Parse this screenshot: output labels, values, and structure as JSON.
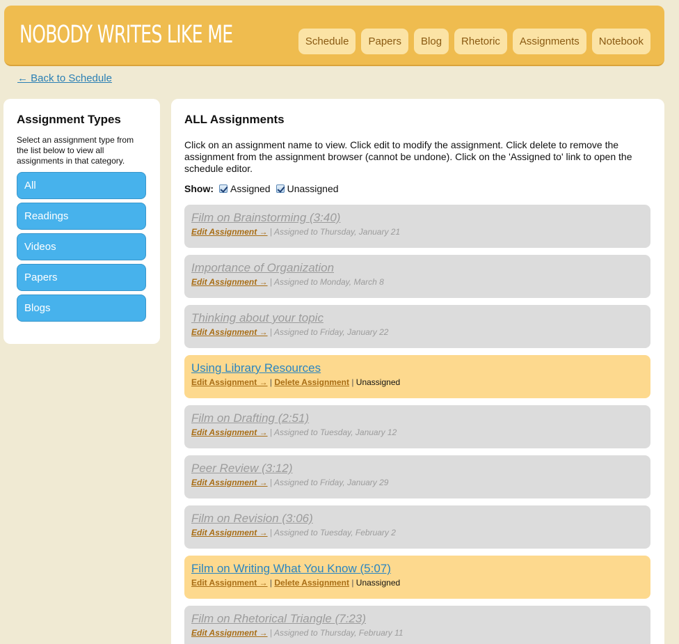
{
  "header": {
    "logo": "NOBODY WRITES LIKE ME",
    "nav": [
      "Schedule",
      "Papers",
      "Blog",
      "Rhetoric",
      "Assignments",
      "Notebook"
    ]
  },
  "back_link": "← Back to Schedule",
  "sidebar": {
    "title": "Assignment Types",
    "description": "Select an assignment type from the list below to view all assignments in that category.",
    "types": [
      "All",
      "Readings",
      "Videos",
      "Papers",
      "Blogs"
    ]
  },
  "main": {
    "title": "ALL Assignments",
    "intro": "Click on an assignment name to view. Click edit to modify the assignment. Click delete to remove the assignment from the assignment browser (cannot be undone). Click on the 'Assigned to' link to open the schedule editor.",
    "show_label": "Show:",
    "filters": [
      "Assigned",
      "Unassigned"
    ],
    "edit_label": "Edit Assignment →",
    "delete_label": "Delete Assignment",
    "separator": "|",
    "assignments": [
      {
        "name": "Film on Brainstorming (3:40)",
        "state": "assigned",
        "status": "Assigned to Thursday, January 21"
      },
      {
        "name": "Importance of Organization",
        "state": "assigned",
        "status": "Assigned to Monday, March 8"
      },
      {
        "name": "Thinking about your topic",
        "state": "assigned",
        "status": "Assigned to Friday, January 22"
      },
      {
        "name": "Using Library Resources",
        "state": "unassigned",
        "status": "Unassigned"
      },
      {
        "name": "Film on Drafting (2:51)",
        "state": "assigned",
        "status": "Assigned to Tuesday, January 12"
      },
      {
        "name": "Peer Review (3:12)",
        "state": "assigned",
        "status": "Assigned to Friday, January 29"
      },
      {
        "name": "Film on Revision (3:06)",
        "state": "assigned",
        "status": "Assigned to Tuesday, February 2"
      },
      {
        "name": "Film on Writing What You Know (5:07)",
        "state": "unassigned",
        "status": "Unassigned"
      },
      {
        "name": "Film on Rhetorical Triangle (7:23)",
        "state": "assigned",
        "status": "Assigned to Thursday, February 11"
      }
    ]
  },
  "colors": {
    "header_bg": "#efbc4f",
    "page_bg": "#f0ead3",
    "type_button": "#47b2ec",
    "assigned_row": "#dcdcdc",
    "unassigned_row": "#fdd98e",
    "link": "#2a7fb4"
  }
}
